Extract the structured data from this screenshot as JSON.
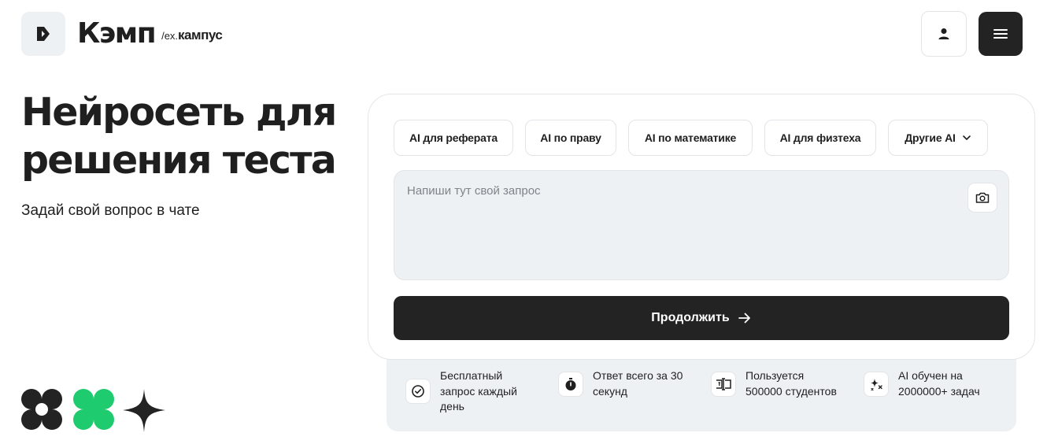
{
  "header": {
    "brand_name": "Кэмп",
    "brand_sub_prefix": "/ex.",
    "brand_sub": "кампус",
    "logo_icon": "k-logo-icon",
    "user_icon": "user-icon",
    "menu_icon": "hamburger-menu-icon"
  },
  "hero": {
    "title": "Нейросеть для решения теста",
    "subtitle": "Задай свой вопрос в чате"
  },
  "card": {
    "chips": [
      {
        "label": "AI для реферата"
      },
      {
        "label": "AI по праву"
      },
      {
        "label": "AI по математике"
      },
      {
        "label": "AI для физтеха"
      },
      {
        "label": "Другие AI"
      }
    ],
    "placeholder": "Напиши тут свой запрос",
    "continue_label": "Продолжить"
  },
  "features": [
    {
      "text": "Бесплатный\nзапрос каждый\nдень",
      "icon": "check-circle-icon"
    },
    {
      "text": "Ответ всего за 30\nсекунд",
      "icon": "stopwatch-icon"
    },
    {
      "text": "Пользуется\n500000 студентов",
      "icon": "text-cursor-icon"
    },
    {
      "text": "AI обучен на\n2000000+ задач",
      "icon": "sparkles-icon"
    }
  ],
  "colors": {
    "dark": "#232323",
    "accent_green": "#1fcb6f",
    "panel_bg": "#eef1f4"
  }
}
